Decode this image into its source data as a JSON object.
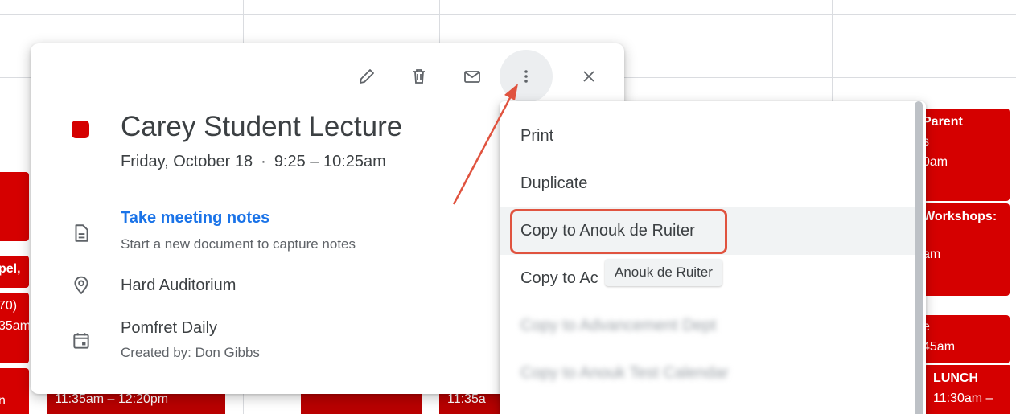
{
  "colors": {
    "event_red": "#d50000",
    "link_blue": "#1a73e8",
    "annotation": "#e0533f"
  },
  "background_events": [
    {
      "line1": "Parent",
      "line2": "s",
      "line3": "0am"
    },
    {
      "line1": "Workshops:",
      "line2": "",
      "line3": "am"
    },
    {
      "line1": "pel,",
      "line2": "",
      "line3": ""
    },
    {
      "line1": "70)",
      "line2": "35am",
      "line3": ""
    },
    {
      "line1": "e",
      "line2": "45am",
      "line3": ""
    },
    {
      "line1": "LUNCH",
      "line2": "11:30am –",
      "line3": ""
    },
    {
      "line1": "11:35am – 12:20pm"
    },
    {
      "line1": "11:35a"
    },
    {
      "line1": "n"
    }
  ],
  "toolbar": {
    "edit_icon": "pencil-icon",
    "delete_icon": "trash-icon",
    "email_icon": "mail-icon",
    "more_icon": "more-vert-icon",
    "close_icon": "close-icon"
  },
  "event": {
    "title": "Carey Student Lecture",
    "date": "Friday, October 18",
    "separator": "·",
    "time": "9:25 – 10:25am",
    "notes_link": "Take meeting notes",
    "notes_sub": "Start a new document to capture notes",
    "location": "Hard Auditorium",
    "calendar": "Pomfret Daily",
    "created_by": "Created by: Don Gibbs"
  },
  "menu": {
    "items": [
      {
        "label": "Print"
      },
      {
        "label": "Duplicate"
      },
      {
        "label": "Copy to Anouk de Ruiter"
      },
      {
        "label": "Copy to Ac"
      },
      {
        "label": "Copy to Advancement Dept"
      },
      {
        "label": "Copy to Anouk Test Calendar"
      }
    ],
    "tooltip": "Anouk de Ruiter"
  }
}
